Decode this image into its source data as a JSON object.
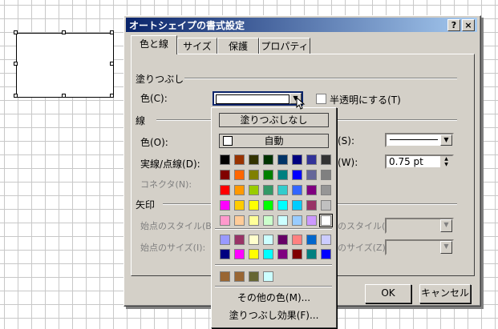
{
  "dialog": {
    "title": "オートシェイプの書式設定",
    "help_btn": "?",
    "close_btn": "×",
    "tabs": [
      "色と線",
      "サイズ",
      "保護",
      "プロパティ"
    ],
    "fill": {
      "section": "塗りつぶし",
      "color_label": "色(C):",
      "transparent_label": "半透明にする(T)"
    },
    "line": {
      "section": "線",
      "color_label": "色(O):",
      "dash_label": "実線/点線(D):",
      "connector_label": "コネクタ(N):",
      "style_label": "(S):",
      "weight_label": "(W):",
      "weight_value": "0.75 pt"
    },
    "arrows": {
      "section": "矢印",
      "begin_style": "始点のスタイル(B):",
      "begin_size": "始点のサイズ(I):",
      "end_style": "のスタイル(E):",
      "end_size": "のサイズ(Z):"
    },
    "ok": "OK",
    "cancel": "キャンセル"
  },
  "palette": {
    "no_fill": "塗りつぶしなし",
    "auto": "自動",
    "more_colors": "その他の色(M)...",
    "fill_effects": "塗りつぶし効果(F)...",
    "colors": [
      [
        "#000000",
        "#993300",
        "#333300",
        "#003300",
        "#003366",
        "#000080",
        "#333399",
        "#333333"
      ],
      [
        "#800000",
        "#ff6600",
        "#808000",
        "#008000",
        "#008080",
        "#0000ff",
        "#666699",
        "#808080"
      ],
      [
        "#ff0000",
        "#ff9900",
        "#99cc00",
        "#339966",
        "#33cccc",
        "#3366ff",
        "#800080",
        "#969696"
      ],
      [
        "#ff00ff",
        "#ffcc00",
        "#ffff00",
        "#00ff00",
        "#00ffff",
        "#00ccff",
        "#993366",
        "#c0c0c0"
      ],
      [
        "#ff99cc",
        "#ffcc99",
        "#ffff99",
        "#ccffcc",
        "#ccffff",
        "#99ccff",
        "#cc99ff",
        "#ffffff"
      ]
    ],
    "chart_colors": [
      [
        "#9999ff",
        "#993366",
        "#ffffcc",
        "#ccffff",
        "#660066",
        "#ff8080",
        "#0066cc",
        "#ccccff"
      ],
      [
        "#000080",
        "#ff00ff",
        "#ffff00",
        "#00ffff",
        "#800080",
        "#800000",
        "#008080",
        "#0000ff"
      ]
    ],
    "recent_colors": [
      "#996633",
      "#996633",
      "#666633",
      "#ccffff"
    ]
  }
}
